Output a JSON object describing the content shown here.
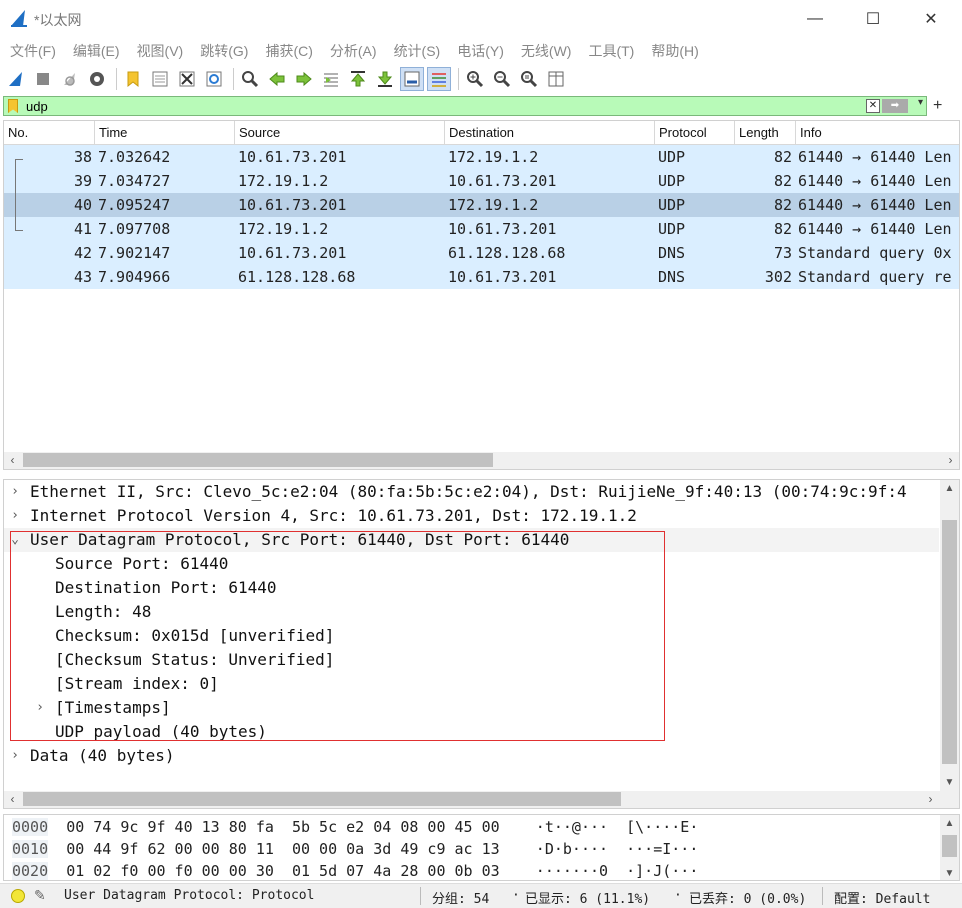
{
  "window": {
    "title": "*以太网",
    "controls": {
      "minimize": "—",
      "maximize": "☐",
      "close": "✕"
    }
  },
  "menu": [
    "文件(F)",
    "编辑(E)",
    "视图(V)",
    "跳转(G)",
    "捕获(C)",
    "分析(A)",
    "统计(S)",
    "电话(Y)",
    "无线(W)",
    "工具(T)",
    "帮助(H)"
  ],
  "toolbar": {
    "icons": [
      "start-capture-icon",
      "stop-capture-icon",
      "restart-capture-icon",
      "capture-options-icon",
      "open-file-icon",
      "save-file-icon",
      "close-file-icon",
      "reload-file-icon",
      "find-packet-icon",
      "go-back-icon",
      "go-forward-icon",
      "go-to-packet-icon",
      "go-first-icon",
      "go-last-icon",
      "autoscroll-icon",
      "colorize-icon",
      "zoom-in-icon",
      "zoom-out-icon",
      "zoom-normal-icon",
      "resize-columns-icon"
    ]
  },
  "filter": {
    "value": "udp",
    "clear": "✕",
    "apply": "➡",
    "dropdown": "▾",
    "add": "+"
  },
  "packet_list": {
    "columns": [
      "No.",
      "Time",
      "Source",
      "Destination",
      "Protocol",
      "Length",
      "Info"
    ],
    "rows": [
      {
        "no": "38",
        "time": "7.032642",
        "src": "10.61.73.201",
        "dst": "172.19.1.2",
        "proto": "UDP",
        "len": "82",
        "info": "61440 → 61440 Len"
      },
      {
        "no": "39",
        "time": "7.034727",
        "src": "172.19.1.2",
        "dst": "10.61.73.201",
        "proto": "UDP",
        "len": "82",
        "info": "61440 → 61440 Len"
      },
      {
        "no": "40",
        "time": "7.095247",
        "src": "10.61.73.201",
        "dst": "172.19.1.2",
        "proto": "UDP",
        "len": "82",
        "info": "61440 → 61440 Len"
      },
      {
        "no": "41",
        "time": "7.097708",
        "src": "172.19.1.2",
        "dst": "10.61.73.201",
        "proto": "UDP",
        "len": "82",
        "info": "61440 → 61440 Len"
      },
      {
        "no": "42",
        "time": "7.902147",
        "src": "10.61.73.201",
        "dst": "61.128.128.68",
        "proto": "DNS",
        "len": "73",
        "info": "Standard query 0x"
      },
      {
        "no": "43",
        "time": "7.904966",
        "src": "61.128.128.68",
        "dst": "10.61.73.201",
        "proto": "DNS",
        "len": "302",
        "info": "Standard query re"
      }
    ],
    "selected_row": "40",
    "scroll": {
      "left": "‹",
      "right": "›"
    }
  },
  "details": [
    {
      "text": "Ethernet II, Src: Clevo_5c:e2:04 (80:fa:5b:5c:e2:04), Dst: RuijieNe_9f:40:13 (00:74:9c:9f:4",
      "arrow": "›"
    },
    {
      "text": "Internet Protocol Version 4, Src: 10.61.73.201, Dst: 172.19.1.2",
      "arrow": "›"
    },
    {
      "text": "User Datagram Protocol, Src Port: 61440, Dst Port: 61440",
      "arrow": "⌄"
    },
    {
      "text": "Source Port: 61440",
      "arrow": ""
    },
    {
      "text": "Destination Port: 61440",
      "arrow": ""
    },
    {
      "text": "Length: 48",
      "arrow": ""
    },
    {
      "text": "Checksum: 0x015d [unverified]",
      "arrow": ""
    },
    {
      "text": "[Checksum Status: Unverified]",
      "arrow": ""
    },
    {
      "text": "[Stream index: 0]",
      "arrow": ""
    },
    {
      "text": "[Timestamps]",
      "arrow": "›"
    },
    {
      "text": "UDP payload (40 bytes)",
      "arrow": ""
    },
    {
      "text": "Data (40 bytes)",
      "arrow": "›"
    }
  ],
  "bytes": [
    {
      "offset": "0000",
      "hex": "00 74 9c 9f 40 13 80 fa  5b 5c e2 04 08 00 45 00",
      "ascii": "·t··@···  [\\····E·"
    },
    {
      "offset": "0010",
      "hex": "00 44 9f 62 00 00 80 11  00 00 0a 3d 49 c9 ac 13",
      "ascii": "·D·b····  ···=I···"
    },
    {
      "offset": "0020",
      "hex": "01 02 f0 00 f0 00 00 30  01 5d 07 4a 28 00 0b 03",
      "ascii": "·······0  ·]·J(···"
    }
  ],
  "status": {
    "field": "User Datagram Protocol: Protocol",
    "packets": "分组: 54",
    "displayed": "已显示: 6 (11.1%)",
    "dropped": "已丢弃: 0 (0.0%)",
    "profile": "配置: Default"
  },
  "colors": {
    "filter_bg": "#b8fab8",
    "row_bg": "#daeeff",
    "row_selected": "#b9d0e6",
    "highlight": "#e03030"
  }
}
